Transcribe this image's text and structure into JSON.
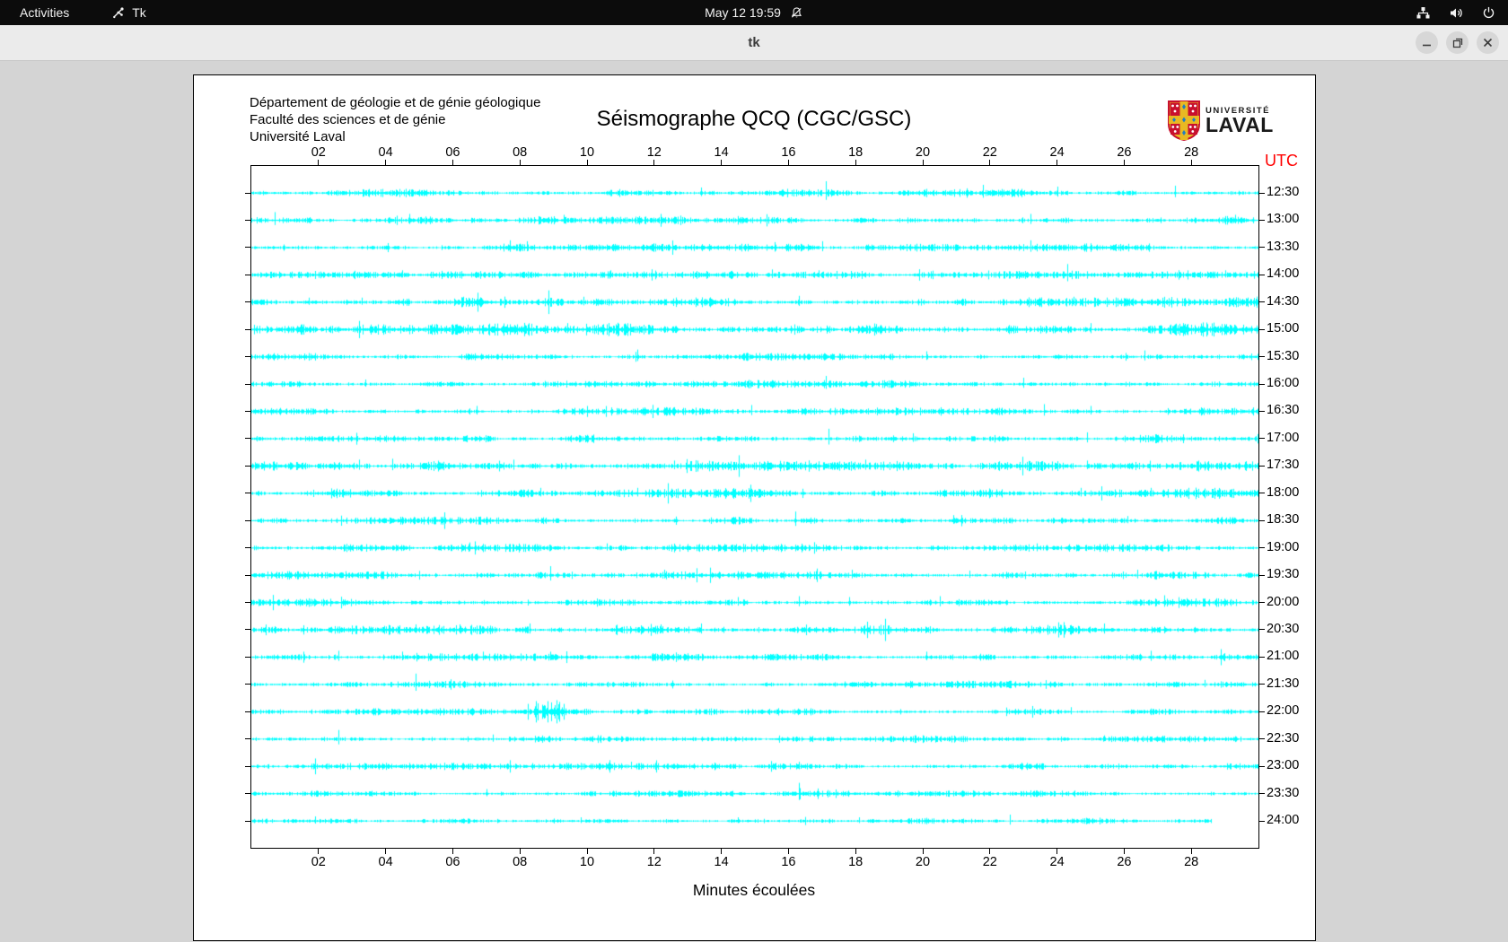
{
  "topbar": {
    "activities": "Activities",
    "app_name": "Tk",
    "clock": "May 12  19:59",
    "icons": [
      "notifications-muted",
      "network",
      "volume",
      "power"
    ]
  },
  "titlebar": {
    "title": "tk",
    "buttons": [
      "minimize",
      "maximize",
      "close"
    ]
  },
  "canvas": {
    "dept_lines": [
      "Département de géologie et de génie géologique",
      "Faculté des sciences et de génie",
      "Université Laval"
    ],
    "title": "Séismographe QCQ (CGC/GSC)",
    "xlabel": "Minutes écoulées",
    "utc_label": "UTC",
    "logo": {
      "line1": "UNIVERSITÉ",
      "line2": "LAVAL"
    }
  },
  "chart_data": {
    "type": "line",
    "subtype": "seismogram-helicorder",
    "station": "QCQ (CGC/GSC)",
    "trace_color": "#00ffff",
    "axis_color": "#000000",
    "x_range_minutes": [
      0,
      30
    ],
    "x_ticks": [
      "02",
      "04",
      "06",
      "08",
      "10",
      "12",
      "14",
      "16",
      "18",
      "20",
      "22",
      "24",
      "26",
      "28"
    ],
    "x_tick_minutes": [
      2,
      4,
      6,
      8,
      10,
      12,
      14,
      16,
      18,
      20,
      22,
      24,
      26,
      28
    ],
    "ylabel_right": "UTC",
    "xlabel": "Minutes écoulées",
    "traces": [
      {
        "label": "12:30",
        "seed": 101,
        "activity": 1.0,
        "end_min": 30,
        "spikes": [
          [
            13.4,
            6
          ],
          [
            17.1,
            13
          ],
          [
            21.8,
            9
          ],
          [
            24.0,
            7
          ],
          [
            27.5,
            8
          ]
        ]
      },
      {
        "label": "13:00",
        "seed": 102,
        "activity": 1.0,
        "end_min": 30,
        "spikes": [
          [
            0.7,
            9
          ],
          [
            4.7,
            7
          ],
          [
            9.3,
            6
          ],
          [
            23.2,
            7
          ],
          [
            29.3,
            6
          ]
        ]
      },
      {
        "label": "13:30",
        "seed": 103,
        "activity": 1.0,
        "end_min": 30,
        "spikes": [
          [
            7.7,
            8
          ],
          [
            8.2,
            7
          ],
          [
            15.6,
            6
          ],
          [
            17.0,
            7
          ],
          [
            23.2,
            8
          ]
        ]
      },
      {
        "label": "14:00",
        "seed": 104,
        "activity": 1.0,
        "end_min": 30,
        "spikes": [
          [
            4.5,
            5
          ],
          [
            10.7,
            5
          ],
          [
            15.5,
            6
          ],
          [
            16.9,
            5
          ],
          [
            24.3,
            12
          ],
          [
            29.0,
            5
          ]
        ]
      },
      {
        "label": "14:30",
        "seed": 105,
        "activity": 1.3,
        "end_min": 30,
        "spikes": [
          [
            1.7,
            5
          ],
          [
            3.3,
            5
          ],
          [
            6.3,
            6
          ],
          [
            9.9,
            6
          ],
          [
            16.3,
            7
          ],
          [
            24.5,
            6
          ]
        ]
      },
      {
        "label": "15:00",
        "seed": 106,
        "activity": 1.7,
        "end_min": 30,
        "spikes": [
          [
            5.5,
            6
          ],
          [
            9.4,
            7
          ],
          [
            18.6,
            6
          ],
          [
            25.0,
            7
          ]
        ]
      },
      {
        "label": "15:30",
        "seed": 107,
        "activity": 1.0,
        "end_min": 30,
        "spikes": [
          [
            11.5,
            8
          ],
          [
            20.1,
            6
          ],
          [
            26.6,
            7
          ]
        ]
      },
      {
        "label": "16:00",
        "seed": 108,
        "activity": 1.0,
        "end_min": 30,
        "spikes": [
          [
            3.4,
            5
          ],
          [
            17.1,
            9
          ],
          [
            23.0,
            7
          ]
        ]
      },
      {
        "label": "16:30",
        "seed": 109,
        "activity": 1.0,
        "end_min": 30,
        "spikes": [
          [
            6.7,
            6
          ],
          [
            14.9,
            7
          ],
          [
            23.6,
            8
          ],
          [
            25.0,
            6
          ]
        ]
      },
      {
        "label": "17:00",
        "seed": 110,
        "activity": 1.05,
        "end_min": 30,
        "spikes": [
          [
            17.2,
            11
          ],
          [
            19.7,
            6
          ],
          [
            24.9,
            7
          ]
        ]
      },
      {
        "label": "17:30",
        "seed": 111,
        "activity": 1.4,
        "end_min": 30,
        "spikes": [
          [
            3.2,
            7
          ],
          [
            4.2,
            8
          ],
          [
            7.8,
            7
          ],
          [
            12.6,
            6
          ],
          [
            18.3,
            7
          ],
          [
            24.9,
            6
          ]
        ]
      },
      {
        "label": "18:00",
        "seed": 112,
        "activity": 1.35,
        "end_min": 30,
        "spikes": [
          [
            8.6,
            6
          ],
          [
            11.5,
            6
          ],
          [
            14.9,
            5
          ],
          [
            24.7,
            6
          ],
          [
            26.8,
            6
          ]
        ]
      },
      {
        "label": "18:30",
        "seed": 113,
        "activity": 1.0,
        "end_min": 30,
        "spikes": [
          [
            16.2,
            10
          ],
          [
            20.9,
            6
          ],
          [
            26.1,
            5
          ]
        ]
      },
      {
        "label": "19:00",
        "seed": 114,
        "activity": 1.05,
        "end_min": 30,
        "spikes": [
          [
            6.5,
            6
          ],
          [
            10.6,
            5
          ],
          [
            23.4,
            5
          ]
        ]
      },
      {
        "label": "19:30",
        "seed": 115,
        "activity": 1.0,
        "end_min": 30,
        "spikes": [
          [
            8.9,
            10
          ],
          [
            12.3,
            6
          ],
          [
            17.9,
            6
          ],
          [
            21.4,
            5
          ],
          [
            26.4,
            6
          ]
        ]
      },
      {
        "label": "20:00",
        "seed": 116,
        "activity": 1.1,
        "end_min": 30,
        "spikes": [
          [
            14.5,
            6
          ],
          [
            16.3,
            7
          ],
          [
            17.8,
            6
          ],
          [
            20.5,
            7
          ],
          [
            27.2,
            8
          ]
        ]
      },
      {
        "label": "20:30",
        "seed": 117,
        "activity": 1.25,
        "end_min": 30,
        "spikes": [
          [
            4.9,
            6
          ],
          [
            6.2,
            6
          ],
          [
            8.3,
            7
          ],
          [
            12.2,
            6
          ],
          [
            13.4,
            7
          ],
          [
            25.4,
            7
          ]
        ]
      },
      {
        "label": "21:00",
        "seed": 118,
        "activity": 1.0,
        "end_min": 30,
        "spikes": [
          [
            2.6,
            7
          ],
          [
            4.5,
            6
          ],
          [
            6.9,
            6
          ],
          [
            8.9,
            6
          ],
          [
            20.1,
            6
          ],
          [
            26.8,
            7
          ]
        ]
      },
      {
        "label": "21:30",
        "seed": 119,
        "activity": 0.95,
        "end_min": 30,
        "spikes": [
          [
            4.9,
            12
          ],
          [
            28.4,
            5
          ]
        ]
      },
      {
        "label": "22:00",
        "seed": 120,
        "activity": 0.95,
        "end_min": 30,
        "bursts": [
          [
            8.4,
            9.4,
            3.0
          ]
        ],
        "spikes": [
          [
            8.7,
            6
          ],
          [
            9.1,
            7
          ],
          [
            24.4,
            5
          ]
        ]
      },
      {
        "label": "22:30",
        "seed": 121,
        "activity": 0.9,
        "end_min": 30,
        "spikes": [
          [
            2.6,
            10
          ],
          [
            7.2,
            5
          ],
          [
            25.4,
            4
          ]
        ]
      },
      {
        "label": "23:00",
        "seed": 122,
        "activity": 0.9,
        "end_min": 30,
        "spikes": [
          [
            11.3,
            5
          ],
          [
            16.3,
            5
          ]
        ]
      },
      {
        "label": "23:30",
        "seed": 123,
        "activity": 0.8,
        "end_min": 30,
        "spikes": [
          [
            7.0,
            5
          ],
          [
            16.3,
            12
          ]
        ]
      },
      {
        "label": "24:00",
        "seed": 124,
        "activity": 0.8,
        "end_min": 28.6,
        "spikes": [
          [
            1.9,
            5
          ],
          [
            9.8,
            4
          ],
          [
            14.5,
            4
          ],
          [
            18.1,
            4
          ],
          [
            22.6,
            7
          ]
        ]
      }
    ]
  }
}
